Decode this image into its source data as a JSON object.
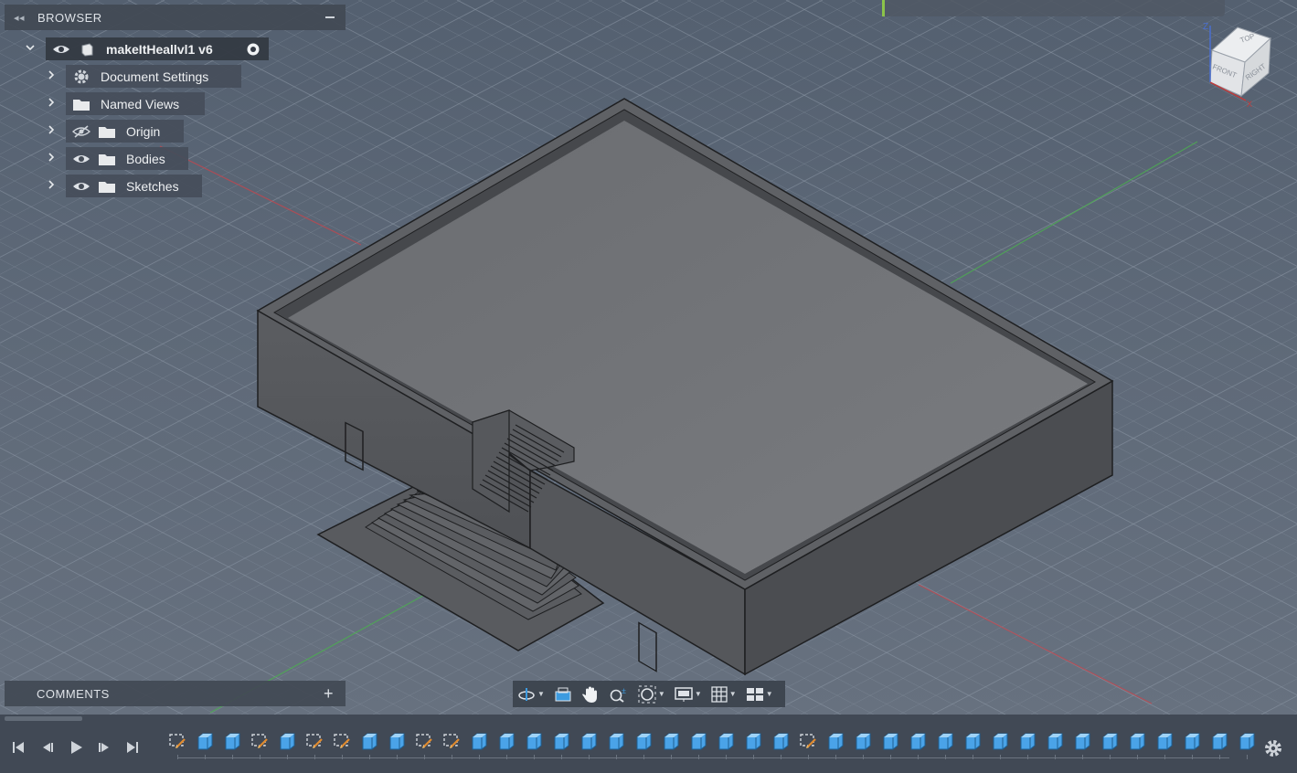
{
  "browser": {
    "title": "BROWSER",
    "document": {
      "name": "makeItHeallvl1 v6"
    },
    "items": [
      {
        "label": "Document Settings",
        "icon": "gear-icon"
      },
      {
        "label": "Named Views",
        "icon": "folder-icon"
      },
      {
        "label": "Origin",
        "icon": "folder-icon",
        "visibility": "hidden"
      },
      {
        "label": "Bodies",
        "icon": "folder-icon",
        "visibility": "visible"
      },
      {
        "label": "Sketches",
        "icon": "folder-icon",
        "visibility": "visible"
      }
    ]
  },
  "comments": {
    "title": "COMMENTS"
  },
  "viewcube": {
    "top": "TOP",
    "front": "FRONT",
    "right": "RIGHT",
    "axis_z": "Z",
    "axis_x": "X"
  },
  "navigation_toolbar": [
    "orbit",
    "look-at",
    "pan",
    "zoom",
    "fit",
    "display-settings",
    "grid-settings",
    "viewports"
  ],
  "timeline": {
    "controls": [
      "go-to-start",
      "previous-step",
      "play",
      "next-step",
      "go-to-end"
    ],
    "features": [
      "sketch",
      "extrude",
      "extrude",
      "sketch",
      "extrude",
      "sketch",
      "sketch",
      "extrude",
      "extrude",
      "sketch",
      "sketch",
      "extrude",
      "extrude",
      "extrude",
      "extrude",
      "extrude",
      "extrude",
      "extrude",
      "extrude",
      "extrude",
      "extrude",
      "extrude",
      "extrude",
      "sketch",
      "extrude",
      "extrude",
      "extrude",
      "extrude",
      "extrude",
      "extrude",
      "extrude",
      "extrude",
      "extrude",
      "extrude",
      "extrude",
      "extrude",
      "extrude",
      "extrude",
      "extrude",
      "extrude"
    ]
  },
  "colors": {
    "background_top": "#546070",
    "background_bottom": "#67717f",
    "grid": "#8a95a3",
    "axis_red": "#c0474f",
    "axis_green": "#4caf50",
    "body_top": "#6f7174",
    "panel": "#424954",
    "accent": "#3d9be0"
  }
}
